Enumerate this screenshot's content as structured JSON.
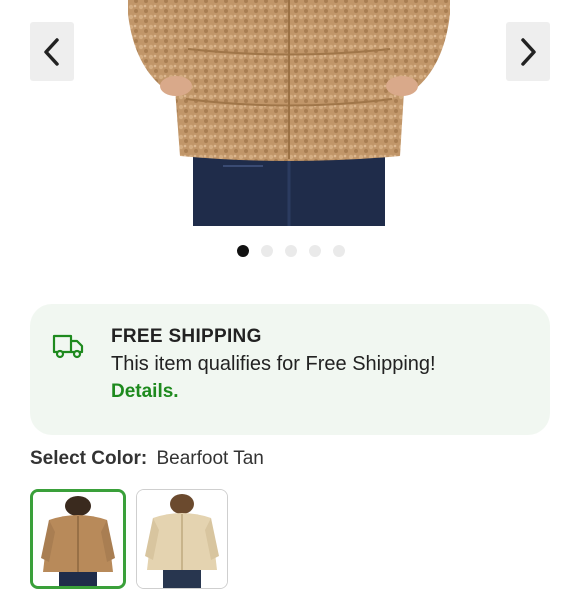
{
  "gallery": {
    "image_alt": "Brown sherpa fleece jacket worn with dark denim jeans",
    "prev_icon": "chevron-left-icon",
    "next_icon": "chevron-right-icon",
    "dot_count": 5,
    "active_dot": 1
  },
  "shipping": {
    "icon": "truck-icon",
    "title": "FREE SHIPPING",
    "message": "This item qualifies for Free Shipping!",
    "link_label": "Details."
  },
  "color": {
    "label": "Select Color:",
    "selected": "Bearfoot Tan",
    "swatches": [
      {
        "name": "Bearfoot Tan",
        "selected": true
      },
      {
        "name": "Cream",
        "selected": false
      }
    ]
  },
  "colors": {
    "accent_green": "#1e8a1e",
    "card_bg": "#f1f7f1",
    "selected_border": "#3aa03a"
  }
}
